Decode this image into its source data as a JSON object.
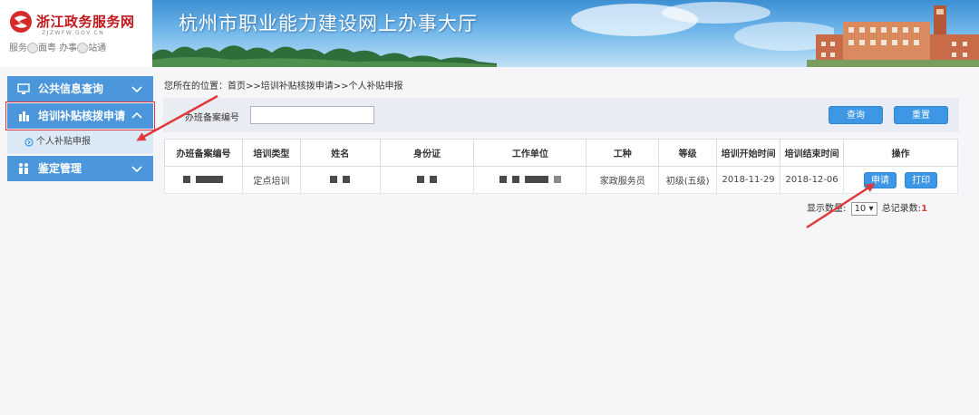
{
  "header": {
    "logo_title": "浙江政务服务网",
    "logo_url": "ZJZWFW.GOV.CN",
    "slogan_a": "服务",
    "slogan_b": "面粤",
    "slogan_c": "办事",
    "slogan_d": "站通",
    "title": "杭州市职业能力建设网上办事大厅"
  },
  "sidebar": {
    "items": [
      {
        "label": "公共信息查询",
        "icon": "monitor-icon",
        "expanded": false
      },
      {
        "label": "培训补贴核拨申请",
        "icon": "person-hand-icon",
        "expanded": true
      },
      {
        "label": "鉴定管理",
        "icon": "people-icon",
        "expanded": false
      }
    ],
    "submenu": {
      "label": "个人补贴申报",
      "icon": "circle-arrow-icon"
    }
  },
  "breadcrumb": "您所在的位置：首页>>培训补贴核拨申请>>个人补贴申报",
  "search": {
    "label": "办班备案编号",
    "value": "",
    "query_label": "查询",
    "reset_label": "重置"
  },
  "table": {
    "headers": [
      "办班备案编号",
      "培训类型",
      "姓名",
      "身份证",
      "工作单位",
      "工种",
      "等级",
      "培训开始时间",
      "培训结束时间",
      "操作"
    ],
    "rows": [
      {
        "type": "定点培训",
        "job": "家政服务员",
        "level": "初级(五级)",
        "start": "2018-11-29",
        "end": "2018-12-06",
        "apply": "申请",
        "print": "打印"
      }
    ]
  },
  "pager": {
    "show_label": "显示数量:",
    "page_size": "10 ▾",
    "total_label": "总记录数:",
    "total": "1"
  },
  "colors": {
    "accent": "#3d97e4",
    "menu": "#4c96dc",
    "annotation": "#e0393c"
  }
}
